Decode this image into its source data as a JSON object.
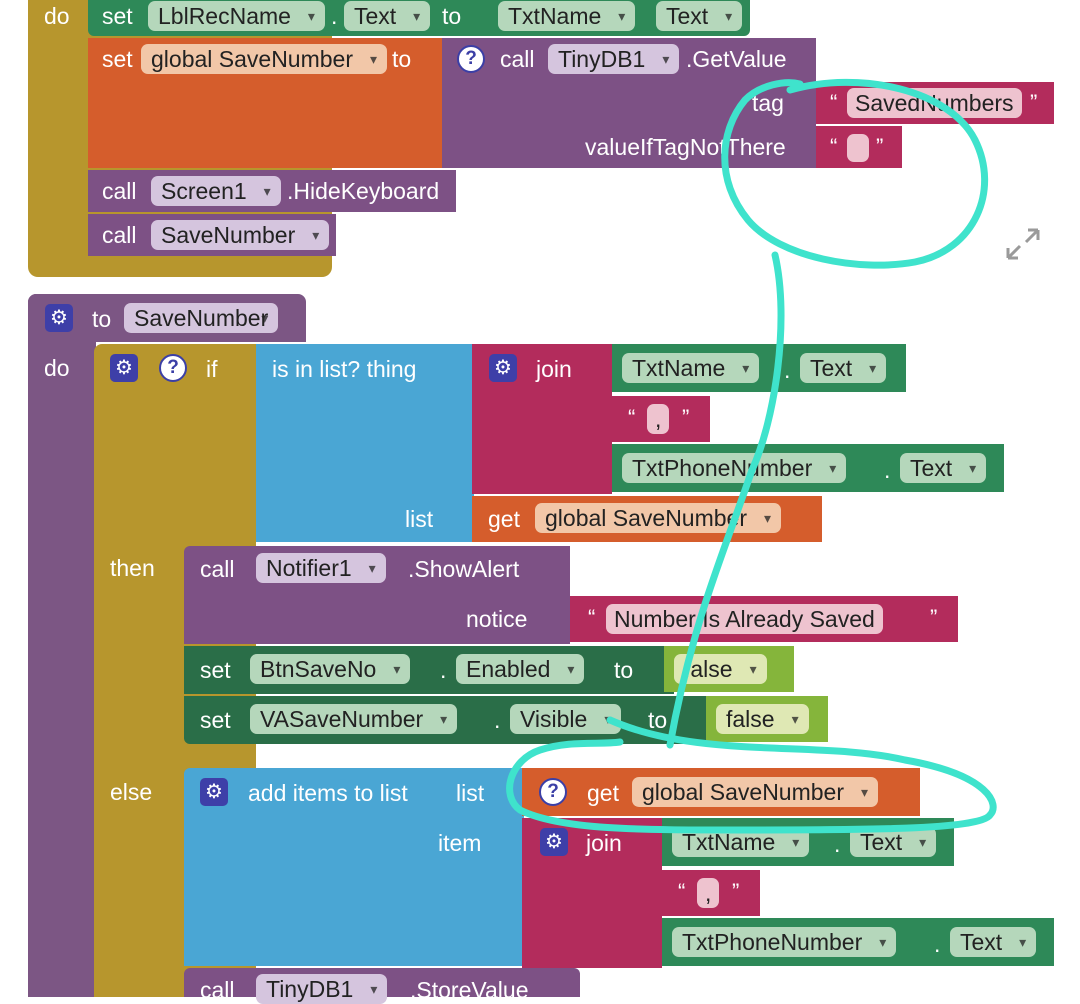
{
  "top": {
    "do": "do",
    "set": "set",
    "lbl_rec_name": "LblRecName",
    "text_prop": "Text",
    "to": "to",
    "txt_name": "TxtName",
    "text_prop2": "Text",
    "set2": "set",
    "global_save_number": "global SaveNumber",
    "to2": "to",
    "call": "call",
    "tinydb": "TinyDB1",
    "get_value": ".GetValue",
    "tag": "tag",
    "saved_numbers": "SavedNumbers",
    "value_if": "valueIfTagNotThere",
    "call_screen": "call",
    "screen1": "Screen1",
    "hide_keyboard": ".HideKeyboard",
    "call_save": "call",
    "save_number": "SaveNumber"
  },
  "proc": {
    "to": "to",
    "name": "SaveNumber",
    "do": "do",
    "if": "if",
    "is_in_list": "is in list? thing",
    "join": "join",
    "txt_name": "TxtName",
    "text1": "Text",
    "comma": ",",
    "txt_phone": "TxtPhoneNumber",
    "text2": "Text",
    "list": "list",
    "get": "get",
    "global_save_number": "global SaveNumber",
    "then": "then",
    "call": "call",
    "notifier": "Notifier1",
    "show_alert": ".ShowAlert",
    "notice": "notice",
    "already_saved": "Number Is Already Saved",
    "set1": "set",
    "btn_save_no": "BtnSaveNo",
    "enabled": "Enabled",
    "to1": "to",
    "false1": "false",
    "set2": "set",
    "va_save_number": "VASaveNumber",
    "visible": "Visible",
    "to2": "to",
    "false2": "false",
    "else": "else",
    "add_items": "add items to list",
    "list2": "list",
    "get2": "get",
    "global_save_number2": "global SaveNumber",
    "item": "item",
    "join2": "join",
    "txt_name2": "TxtName",
    "text3": "Text",
    "comma2": ",",
    "txt_phone2": "TxtPhoneNumber",
    "text4": "Text",
    "call2": "call",
    "tinydb2": "TinyDB1",
    "store_value": ".StoreValue"
  },
  "icons": {
    "help": "question-mark",
    "gear": "gear",
    "expand": "expand-arrows"
  },
  "colors": {
    "event_gold": "#b7962d",
    "component_purple": "#7d5185",
    "variable_orange": "#d55d2c",
    "component_green": "#2e8958",
    "list_blue": "#4aa6d4",
    "text_magenta": "#b32c5c",
    "logic_lightgreen": "#85b53b",
    "annotation_cyan": "#3fe3cc"
  }
}
